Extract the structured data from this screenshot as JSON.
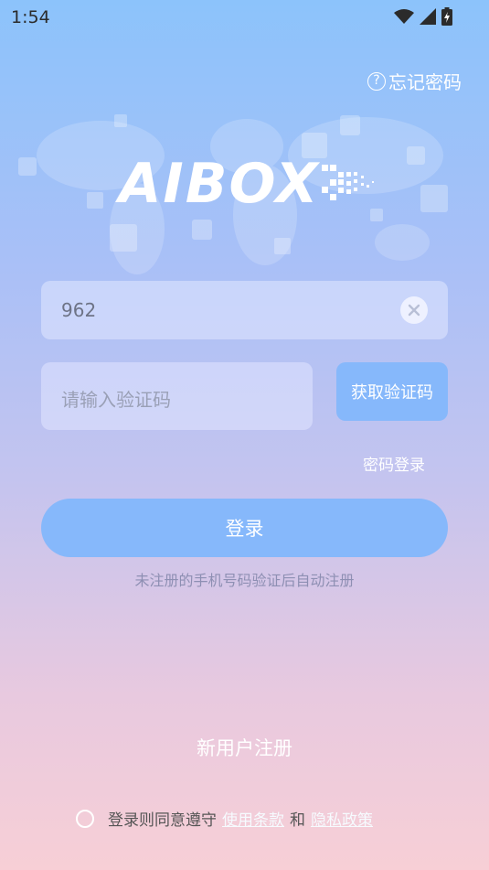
{
  "status_bar": {
    "time": "1:54"
  },
  "header": {
    "forgot_password": "忘记密码"
  },
  "logo": {
    "text": "AIBOX"
  },
  "form": {
    "phone_value": "962",
    "code_placeholder": "请输入验证码",
    "get_code_label": "获取验证码",
    "password_login_label": "密码登录",
    "login_label": "登录",
    "hint": "未注册的手机号码验证后自动注册"
  },
  "footer": {
    "register_label": "新用户注册",
    "agree_prefix": "登录则同意遵守",
    "terms_link": "使用条款",
    "and_text": "和",
    "privacy_link": "隐私政策"
  },
  "colors": {
    "accent": "#86b8fb",
    "gradient_top": "#8cc3fb",
    "gradient_bottom": "#f7cfd6"
  }
}
